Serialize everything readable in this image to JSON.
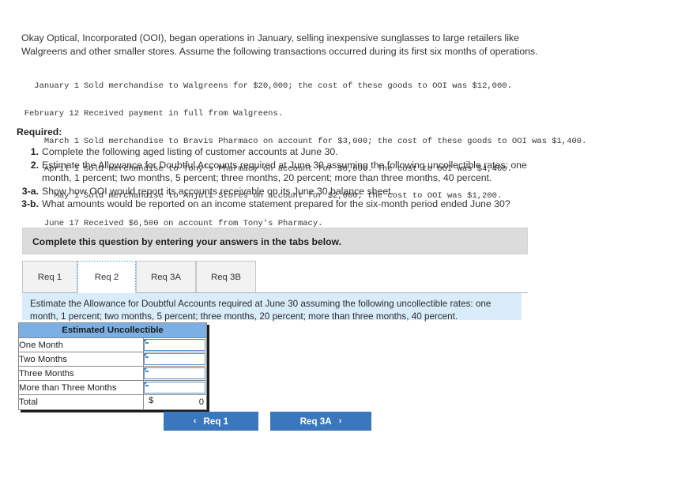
{
  "problem": {
    "intro": "Okay Optical, Incorporated (OOI), began operations in January, selling inexpensive sunglasses to large retailers like Walgreens and other smaller stores. Assume the following transactions occurred during its first six months of operations.",
    "transactions": [
      {
        "date": "January 1",
        "description": "Sold merchandise to Walgreens for $20,000; the cost of these goods to OOI was $12,000."
      },
      {
        "date": "February 12",
        "description": "Received payment in full from Walgreens."
      },
      {
        "date": "March 1",
        "description": "Sold merchandise to Bravis Pharmaco on account for $3,000; the cost of these goods to OOI was $1,400."
      },
      {
        "date": "April 1",
        "description": "Sold merchandise to Tony's Pharmacy on account for $8,000. The cost to OOI was $4,400."
      },
      {
        "date": "May 1",
        "description": "Sold merchandise to Anjuli Stores on account for $2,000; the cost to OOI was $1,200."
      },
      {
        "date": "June 17",
        "description": "Received $6,500 on account from Tony's Pharmacy."
      }
    ],
    "required_label": "Required:",
    "requirements": [
      {
        "num": "1.",
        "text": "Complete the following aged listing of customer accounts at June 30."
      },
      {
        "num": "2.",
        "text": "Estimate the Allowance for Doubtful Accounts required at June 30 assuming the following uncollectible rates: one month, 1 percent; two months, 5 percent; three months, 20 percent; more than three months, 40 percent."
      },
      {
        "num": "3-a.",
        "text": "Show how OOI would report its accounts receivable on its June 30 balance sheet."
      },
      {
        "num": "3-b.",
        "text": "What amounts would be reported on an income statement prepared for the six-month period ended June 30?"
      }
    ]
  },
  "instruction_bar": {
    "text": "Complete this question by entering your answers in the tabs below."
  },
  "tabs": [
    {
      "label": "Req 1",
      "active": false
    },
    {
      "label": "Req 2",
      "active": true
    },
    {
      "label": "Req 3A",
      "active": false
    },
    {
      "label": "Req 3B",
      "active": false
    }
  ],
  "panel": {
    "text": "Estimate the Allowance for Doubtful Accounts required at June 30 assuming the following uncollectible rates: one month, 1 percent; two months, 5 percent; three months, 20 percent; more than three months, 40 percent."
  },
  "answer_table": {
    "header": "Estimated Uncollectible",
    "rows": [
      {
        "label": "One Month",
        "value": ""
      },
      {
        "label": "Two Months",
        "value": ""
      },
      {
        "label": "Three Months",
        "value": ""
      },
      {
        "label": "More than Three Months",
        "value": ""
      }
    ],
    "total": {
      "label": "Total",
      "currency": "$",
      "value": "0"
    }
  },
  "navigation": {
    "prev_label": "Req 1",
    "prev_chevron": "‹",
    "next_label": "Req 3A",
    "next_chevron": "›"
  },
  "colors": {
    "button_blue": "#3b77bd",
    "table_header_blue": "#7cb0e4",
    "panel_blue": "#d9ecfa",
    "instruction_gray": "#dcdcdc",
    "input_border_blue": "#5b8fc7"
  }
}
